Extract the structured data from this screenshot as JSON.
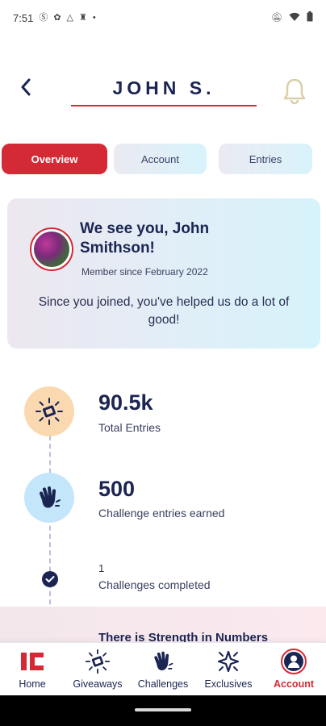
{
  "status_bar": {
    "time": "7:51",
    "left_icons": [
      "s-icon",
      "photos-icon",
      "drive-icon",
      "figure-icon",
      "dot-icon"
    ],
    "right_icons": [
      "mute-icon",
      "wifi-icon",
      "battery-icon"
    ]
  },
  "header": {
    "title": "JOHN S.",
    "accent_color": "#d42a35"
  },
  "tabs": [
    {
      "label": "Overview",
      "active": true
    },
    {
      "label": "Account",
      "active": false
    },
    {
      "label": "Entries",
      "active": false
    }
  ],
  "profile": {
    "greeting": "We see you, John Smithson!",
    "member_since": "Member since February 2022",
    "message": "Since you joined, you've helped us do a lot of good!"
  },
  "stats": [
    {
      "value": "90.5k",
      "label": "Total Entries",
      "icon": "giveaway-icon"
    },
    {
      "value": "500",
      "label": "Challenge entries earned",
      "icon": "wave-hand-icon"
    },
    {
      "value": "1",
      "label": "Challenges completed",
      "icon": "check-icon"
    }
  ],
  "banner": {
    "text": "There is Strength in Numbers"
  },
  "bottom_nav": [
    {
      "label": "Home",
      "icon": "home-logo-icon",
      "active": false
    },
    {
      "label": "Giveaways",
      "icon": "giveaway-icon",
      "active": false
    },
    {
      "label": "Challenges",
      "icon": "wave-hand-icon",
      "active": false
    },
    {
      "label": "Exclusives",
      "icon": "sparkle-icon",
      "active": false
    },
    {
      "label": "Account",
      "icon": "account-icon",
      "active": true
    }
  ],
  "colors": {
    "primary_red": "#d42a35",
    "navy": "#1b2552",
    "entries_circle": "#fbd9b0",
    "challenge_circle": "#c3e6fb"
  }
}
